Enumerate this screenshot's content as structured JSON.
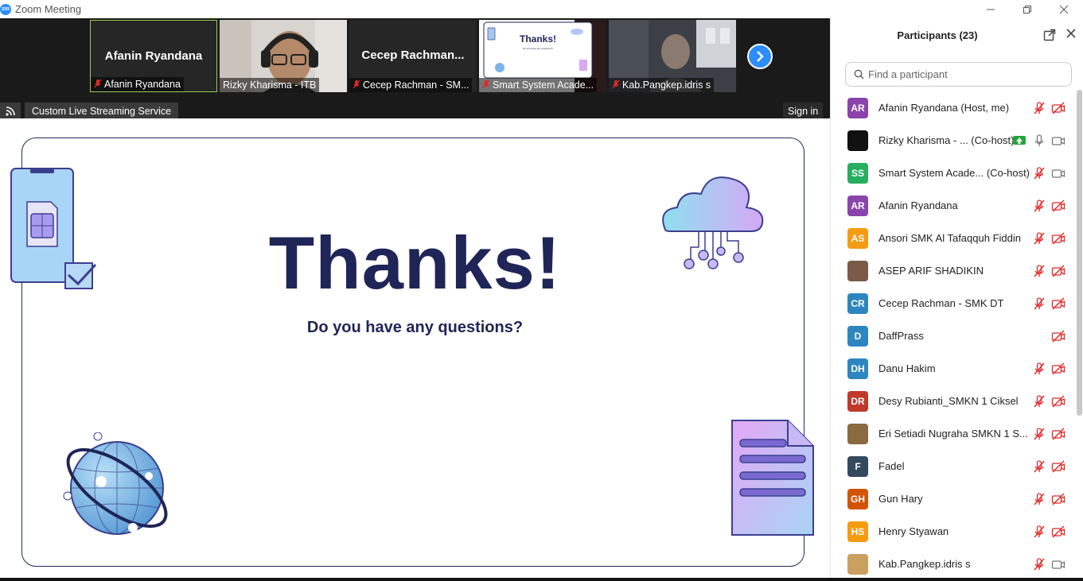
{
  "window": {
    "title": "Zoom Meeting",
    "logo_text": "zm"
  },
  "video_strip": {
    "tiles": [
      {
        "big_name": "Afanin Ryandana",
        "label": "Afanin Ryandana",
        "muted": true,
        "type": "name"
      },
      {
        "big_name": "",
        "label": "Rizky Kharisma - ITB",
        "muted": false,
        "type": "video"
      },
      {
        "big_name": "Cecep  Rachman...",
        "label": "Cecep Rachman - SM...",
        "muted": true,
        "type": "name"
      },
      {
        "big_name": "",
        "label": "Smart System Acade...",
        "muted": true,
        "type": "share"
      },
      {
        "big_name": "",
        "label": "Kab.Pangkep.idris s",
        "muted": true,
        "type": "video"
      }
    ],
    "thumb_slide_title": "Thanks!",
    "thumb_slide_sub": "Do you have any questions?"
  },
  "toolbar": {
    "stream_label": "Custom Live Streaming Service",
    "signin_label": "Sign in"
  },
  "slide": {
    "title": "Thanks!",
    "subtitle": "Do you have any questions?"
  },
  "participants": {
    "title": "Participants (23)",
    "search_placeholder": "Find a participant",
    "items": [
      {
        "initials": "AR",
        "color": "#8b44ac",
        "name": "Afanin Ryandana (Host, me)",
        "mic": "muted",
        "cam": "off",
        "share": false
      },
      {
        "initials": "",
        "color": "#111111",
        "name": "Rizky Kharisma - ... (Co-host)",
        "mic": "on",
        "cam": "on",
        "share": true
      },
      {
        "initials": "SS",
        "color": "#27ae60",
        "name": "Smart System Acade...  (Co-host)",
        "mic": "muted",
        "cam": "on",
        "share": false
      },
      {
        "initials": "AR",
        "color": "#8b44ac",
        "name": "Afanin Ryandana",
        "mic": "muted",
        "cam": "off",
        "share": false
      },
      {
        "initials": "AS",
        "color": "#f39c12",
        "name": "Ansori SMK Al Tafaqquh Fiddin",
        "mic": "muted",
        "cam": "off",
        "share": false
      },
      {
        "initials": "",
        "color": "#7a5a48",
        "name": "ASEP ARIF SHADIKIN",
        "mic": "muted",
        "cam": "off",
        "share": false
      },
      {
        "initials": "CR",
        "color": "#2e86c1",
        "name": "Cecep Rachman - SMK DT",
        "mic": "muted",
        "cam": "off",
        "share": false
      },
      {
        "initials": "D",
        "color": "#2e86c1",
        "name": "DaffPrass",
        "mic": "none",
        "cam": "off",
        "share": false
      },
      {
        "initials": "DH",
        "color": "#2e86c1",
        "name": "Danu Hakim",
        "mic": "muted",
        "cam": "off",
        "share": false
      },
      {
        "initials": "DR",
        "color": "#c0392b",
        "name": "Desy Rubianti_SMKN 1 Ciksel",
        "mic": "muted",
        "cam": "off",
        "share": false
      },
      {
        "initials": "",
        "color": "#8a6a40",
        "name": "Eri Setiadi Nugraha SMKN 1 S...",
        "mic": "muted",
        "cam": "off",
        "share": false
      },
      {
        "initials": "F",
        "color": "#34495e",
        "name": "Fadel",
        "mic": "muted",
        "cam": "off",
        "share": false
      },
      {
        "initials": "GH",
        "color": "#d35400",
        "name": "Gun Hary",
        "mic": "muted",
        "cam": "off",
        "share": false
      },
      {
        "initials": "HS",
        "color": "#f39c12",
        "name": "Henry Styawan",
        "mic": "muted",
        "cam": "off",
        "share": false
      },
      {
        "initials": "",
        "color": "#c9a060",
        "name": "Kab.Pangkep.idris s",
        "mic": "muted",
        "cam": "on",
        "share": false
      }
    ]
  }
}
